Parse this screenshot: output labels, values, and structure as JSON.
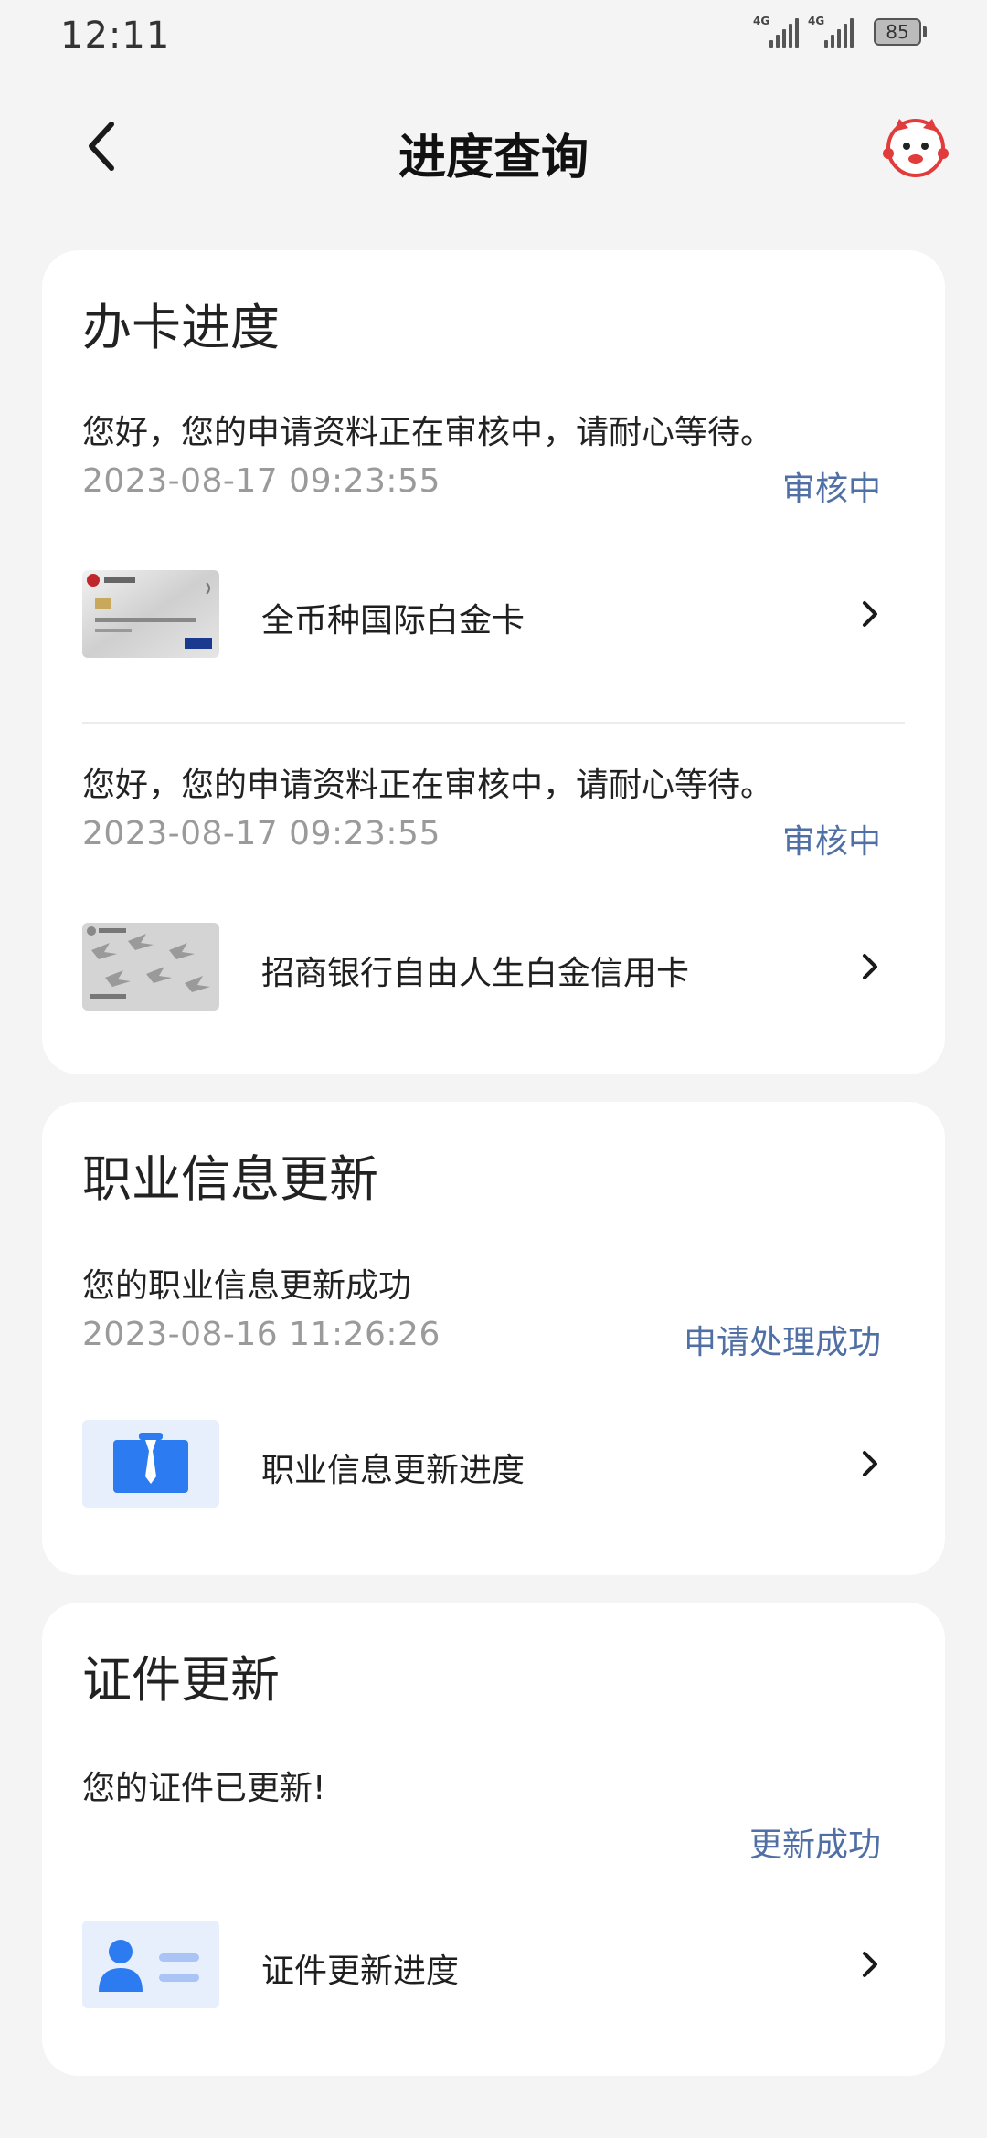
{
  "status_bar": {
    "time": "12:11",
    "network1": "4G",
    "network2": "4G",
    "battery": "85"
  },
  "header": {
    "title": "进度查询",
    "back_icon": "chevron-left-icon",
    "mascot_icon": "assistant-mascot-icon"
  },
  "card_progress": {
    "title": "办卡进度",
    "entries": [
      {
        "message": "您好，您的申请资料正在审核中，请耐心等待。",
        "date": "2023-08-17 09:23:55",
        "status": "审核中",
        "card_name": "全币种国际白金卡"
      },
      {
        "message": "您好，您的申请资料正在审核中，请耐心等待。",
        "date": "2023-08-17 09:23:55",
        "status": "审核中",
        "card_name": "招商银行自由人生白金信用卡"
      }
    ]
  },
  "card_job": {
    "title": "职业信息更新",
    "message": "您的职业信息更新成功",
    "date": "2023-08-16 11:26:26",
    "status": "申请处理成功",
    "row_label": "职业信息更新进度"
  },
  "card_id": {
    "title": "证件更新",
    "message": "您的证件已更新!",
    "status": "更新成功",
    "row_label": "证件更新进度"
  },
  "colors": {
    "background": "#f4f4f4",
    "card": "#ffffff",
    "status_blue": "#4f6fa5",
    "muted": "#9a9a9a",
    "icon_blue": "#2d7bf0"
  }
}
